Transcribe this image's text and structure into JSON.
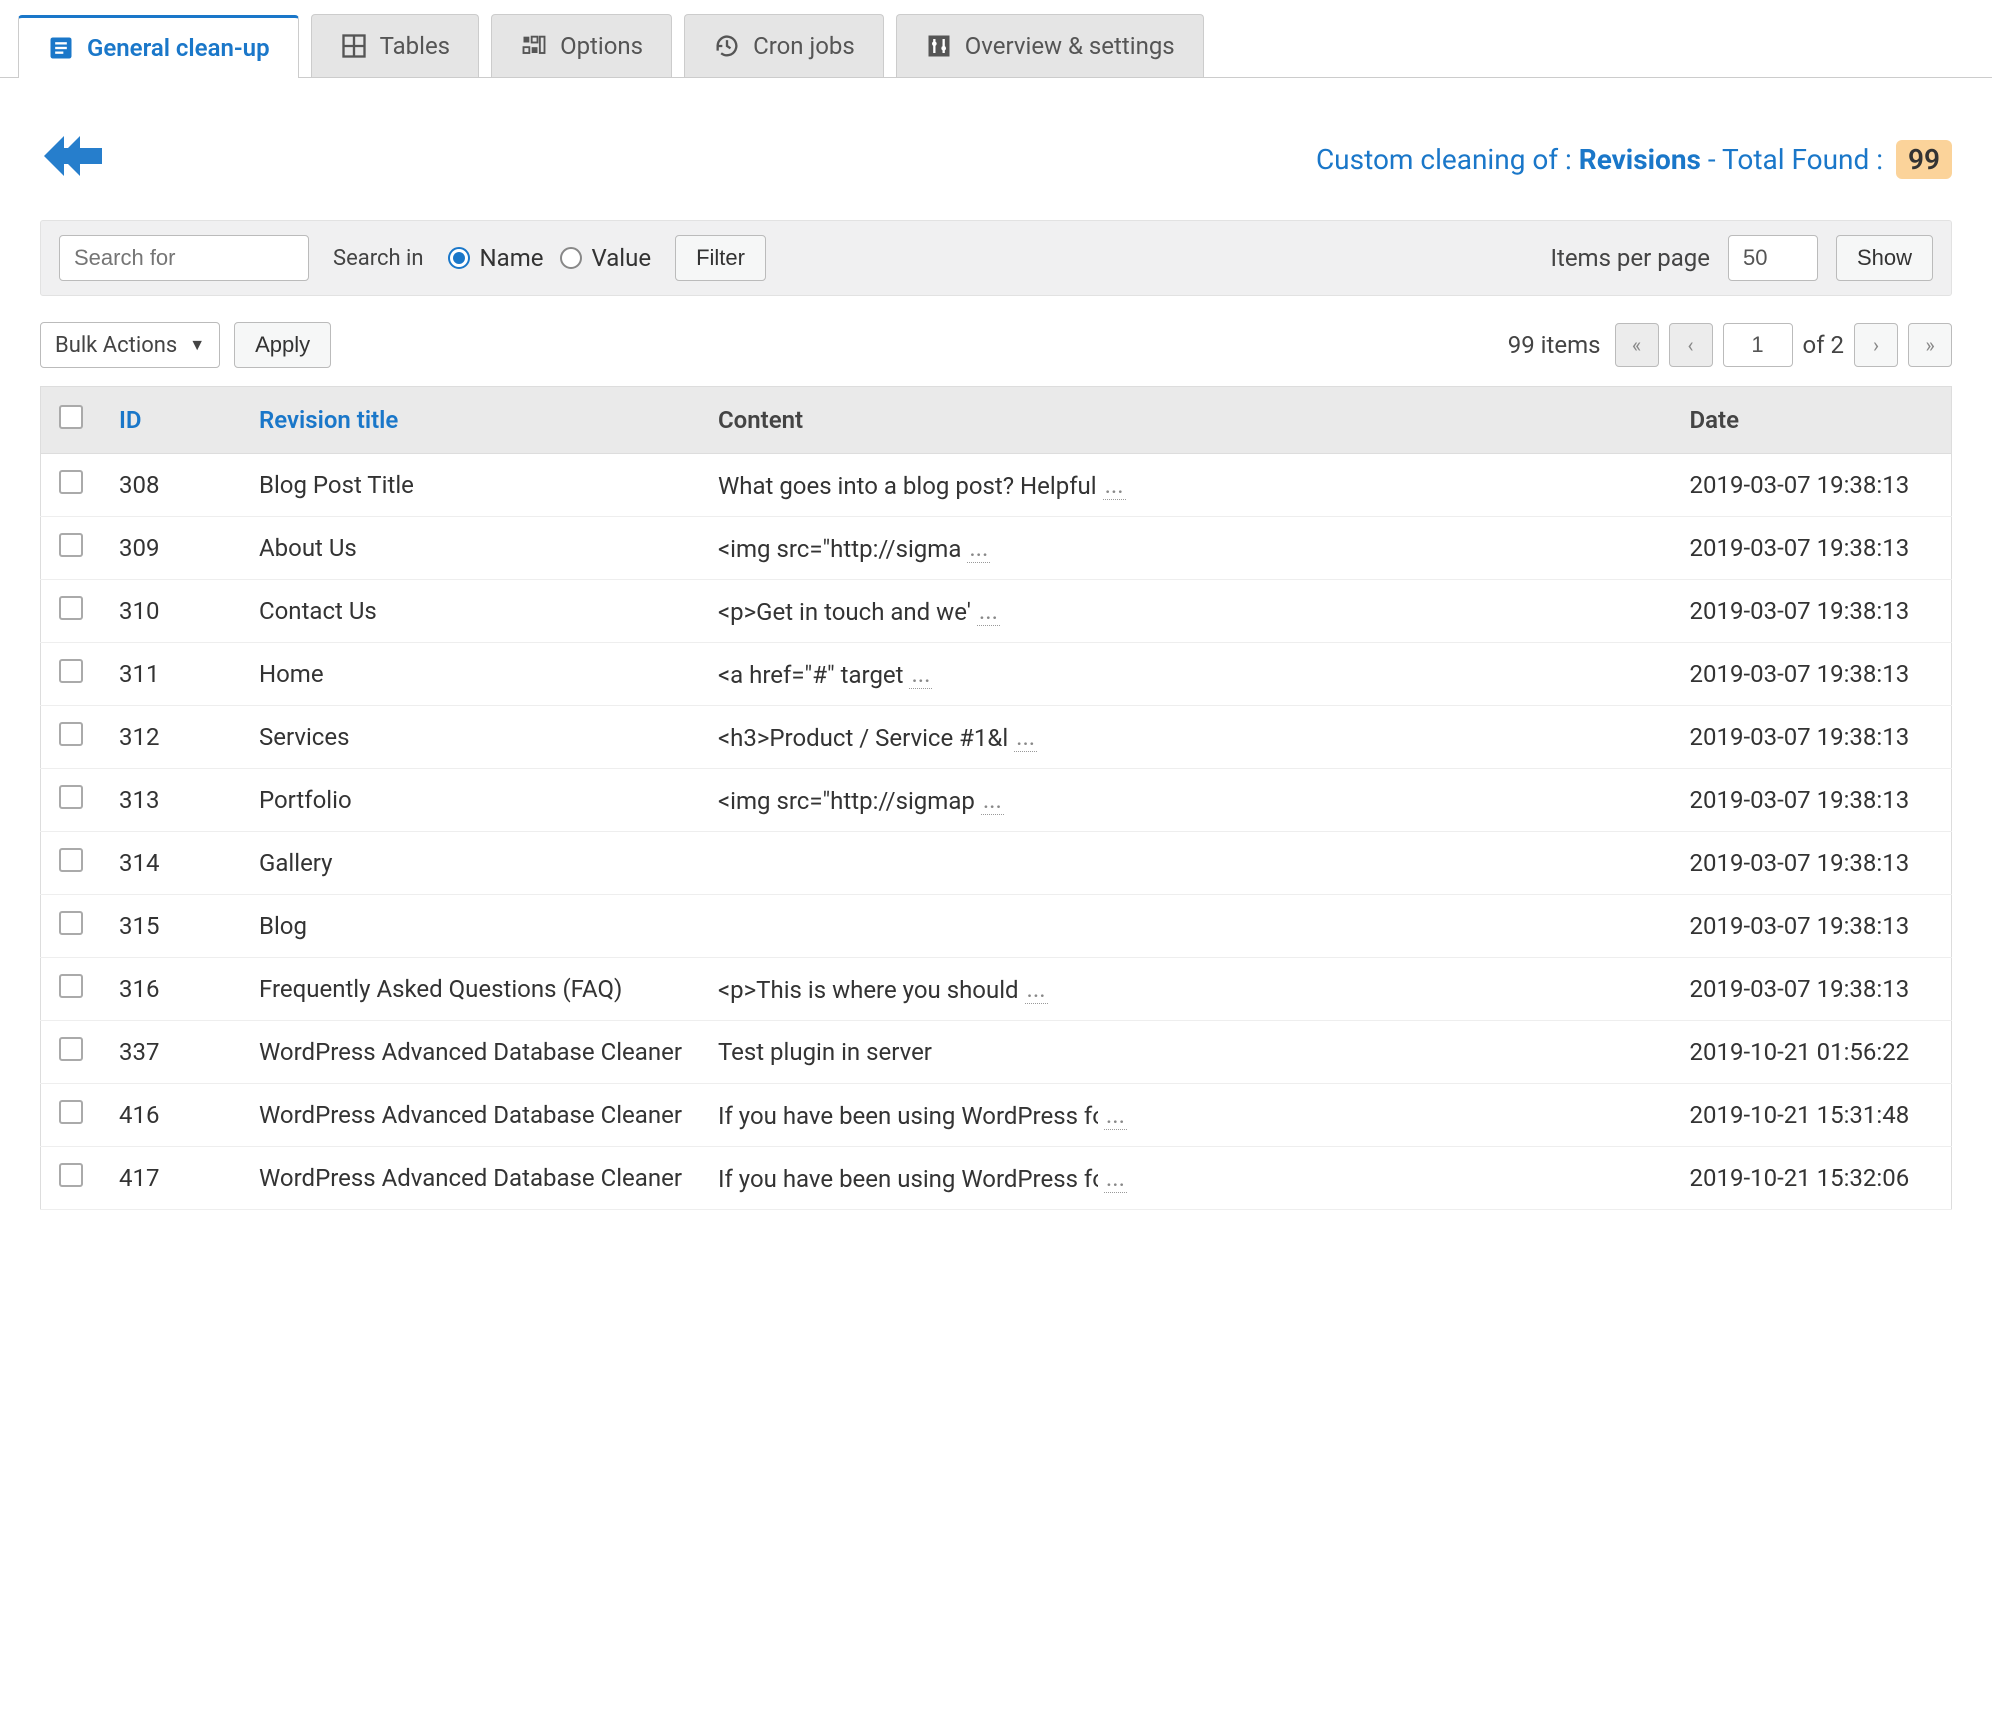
{
  "tabs": [
    {
      "label": "General clean-up",
      "icon": "document-icon",
      "active": true
    },
    {
      "label": "Tables",
      "icon": "grid-icon",
      "active": false
    },
    {
      "label": "Options",
      "icon": "sliders-icon",
      "active": false
    },
    {
      "label": "Cron jobs",
      "icon": "history-icon",
      "active": false
    },
    {
      "label": "Overview & settings",
      "icon": "tuner-icon",
      "active": false
    }
  ],
  "header": {
    "cleaning_of_label": "Custom cleaning of :",
    "type": "Revisions",
    "total_label": "- Total Found :",
    "total_count": "99"
  },
  "filter": {
    "search_placeholder": "Search for",
    "search_in_label": "Search in",
    "radio_name": "Name",
    "radio_value": "Value",
    "radio_selected": "name",
    "filter_btn": "Filter",
    "ipp_label": "Items per page",
    "ipp_value": "50",
    "show_btn": "Show"
  },
  "bulk": {
    "select_label": "Bulk Actions",
    "apply_btn": "Apply",
    "items_count_text": "99 items",
    "page_current": "1",
    "page_of_label": "of 2"
  },
  "columns": {
    "id": "ID",
    "title": "Revision title",
    "content": "Content",
    "date": "Date"
  },
  "rows": [
    {
      "id": "308",
      "title": "Blog Post Title",
      "content": "What goes into a blog post? Helpful",
      "truncated": true,
      "date": "2019-03-07 19:38:13"
    },
    {
      "id": "309",
      "title": "About Us",
      "content": "<img src=\"http://sigma",
      "truncated": true,
      "date": "2019-03-07 19:38:13"
    },
    {
      "id": "310",
      "title": "Contact Us",
      "content": "<p>Get in touch and we'",
      "truncated": true,
      "date": "2019-03-07 19:38:13"
    },
    {
      "id": "311",
      "title": "Home",
      "content": "<a href=\"#\" target",
      "truncated": true,
      "date": "2019-03-07 19:38:13"
    },
    {
      "id": "312",
      "title": "Services",
      "content": "<h3>Product / Service #1&l",
      "truncated": true,
      "date": "2019-03-07 19:38:13"
    },
    {
      "id": "313",
      "title": "Portfolio",
      "content": "<img src=\"http://sigmap",
      "truncated": true,
      "date": "2019-03-07 19:38:13"
    },
    {
      "id": "314",
      "title": "Gallery",
      "content": "",
      "truncated": false,
      "date": "2019-03-07 19:38:13"
    },
    {
      "id": "315",
      "title": "Blog",
      "content": "",
      "truncated": false,
      "date": "2019-03-07 19:38:13"
    },
    {
      "id": "316",
      "title": "Frequently Asked Questions (FAQ)",
      "content": "<p>This is where you should",
      "truncated": true,
      "date": "2019-03-07 19:38:13"
    },
    {
      "id": "337",
      "title": "WordPress Advanced Database Cleaner",
      "content": "Test plugin in server",
      "truncated": false,
      "date": "2019-10-21 01:56:22"
    },
    {
      "id": "416",
      "title": "WordPress Advanced Database Cleaner",
      "content": "If you have been using WordPress fo",
      "truncated": true,
      "date": "2019-10-21 15:31:48"
    },
    {
      "id": "417",
      "title": "WordPress Advanced Database Cleaner",
      "content": "If you have been using WordPress fo",
      "truncated": true,
      "date": "2019-10-21 15:32:06"
    }
  ]
}
